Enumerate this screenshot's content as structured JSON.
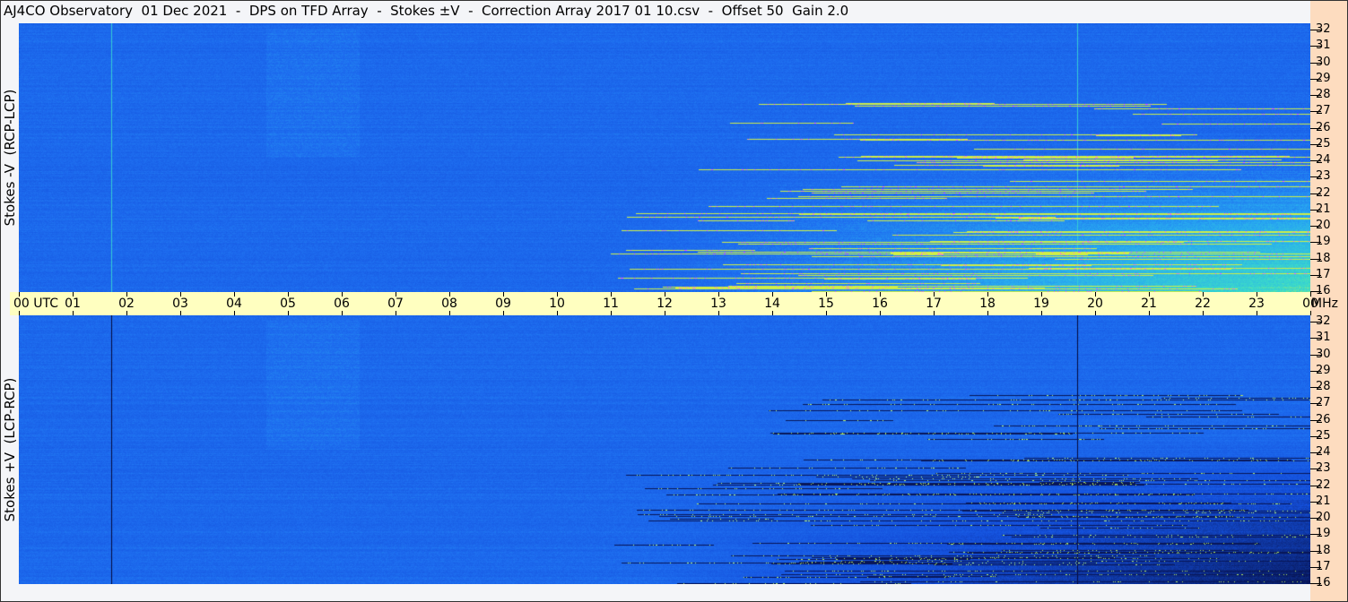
{
  "title": "AJ4CO Observatory  01 Dec 2021  -  DPS on TFD Array  -  Stokes ±V  -  Correction Array 2017 01 10.csv  -  Offset 50  Gain 2.0",
  "colors": {
    "background": "#f4f5f8",
    "axis_strip": "#ffffc0",
    "freq_strip": "#fddcbf",
    "base_blue": "#1a5fe0"
  },
  "chart_data": [
    {
      "type": "heatmap",
      "ylabel": "Stokes -V  (RCP-LCP)",
      "xlim": [
        "00",
        "00"
      ],
      "ylim": [
        16,
        32
      ],
      "y_unit": "MHz",
      "yticks": [
        "32",
        "31",
        "30",
        "29",
        "28",
        "27",
        "26",
        "25",
        "24",
        "23",
        "22",
        "21",
        "20",
        "19",
        "18",
        "17",
        "16"
      ],
      "colorscale": [
        "#0a1a80",
        "#1a5fe0",
        "#20a0f0",
        "#40e0c0",
        "#e0f040",
        "#ff40ff"
      ]
    },
    {
      "type": "heatmap",
      "ylabel": "Stokes +V  (LCP-RCP)",
      "xlim": [
        "00",
        "00"
      ],
      "ylim": [
        16,
        32
      ],
      "y_unit": "MHz",
      "yticks": [
        "32",
        "31",
        "30",
        "29",
        "28",
        "27",
        "26",
        "25",
        "24",
        "23",
        "22",
        "21",
        "20",
        "19",
        "18",
        "17",
        "16"
      ],
      "colorscale": [
        "#000010",
        "#0a1a80",
        "#1a5fe0",
        "#20a0f0",
        "#e0f040"
      ]
    }
  ],
  "time_axis": {
    "first_label": "00  UTC",
    "ticks": [
      "01",
      "02",
      "03",
      "04",
      "05",
      "06",
      "07",
      "08",
      "09",
      "10",
      "11",
      "12",
      "13",
      "14",
      "15",
      "16",
      "17",
      "18",
      "19",
      "20",
      "21",
      "22",
      "23"
    ],
    "last_label": "00",
    "unit": "MHz"
  }
}
